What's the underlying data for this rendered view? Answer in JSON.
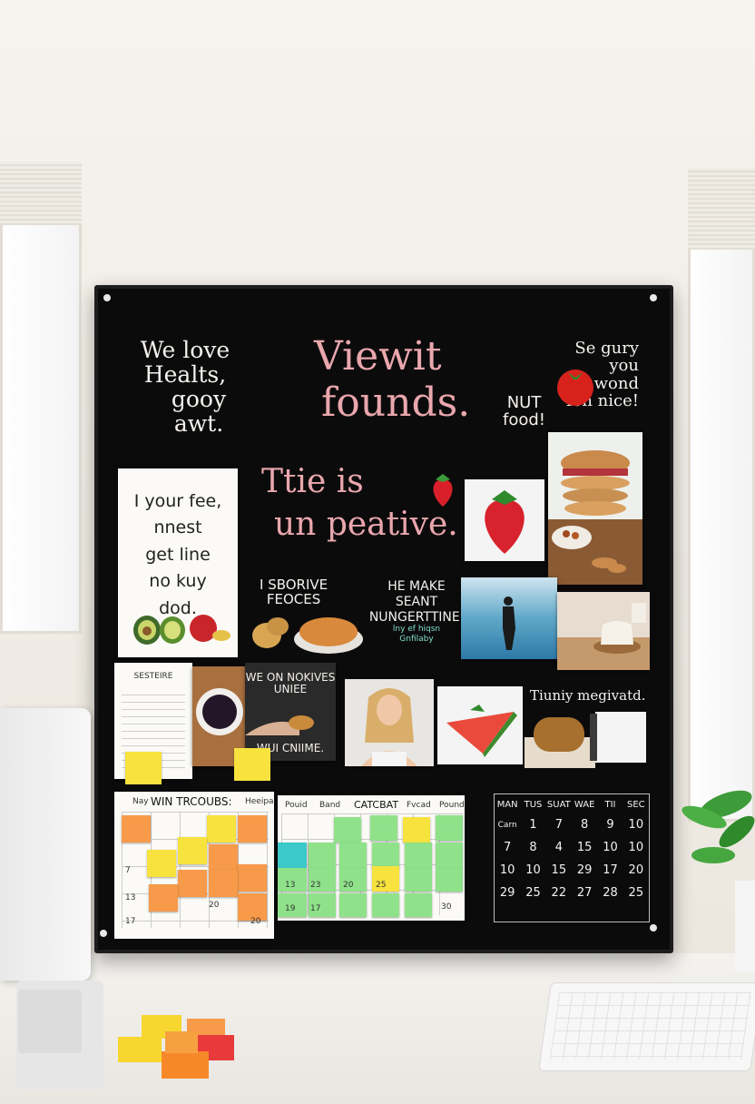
{
  "board": {
    "top_left": {
      "line1": "We love",
      "line2": "Healts,",
      "line3": "gooy",
      "line4": "awt."
    },
    "headline": {
      "line1": "Viewit",
      "line2": "founds."
    },
    "tagline": {
      "line1": "Ttie is",
      "line2": "un peative."
    },
    "top_right": {
      "line1": "Se gury",
      "line2": "you",
      "line3": "uwond",
      "line4": "fon nice!"
    },
    "nut_food": {
      "line1": "NUT",
      "line2": "food!"
    },
    "poster": {
      "line1": "I your fee,",
      "line2": "nnest",
      "line3": "get line",
      "line4": "no kuy",
      "line5": "dod."
    },
    "sborive": {
      "line1": "I SBORIVE",
      "line2": "FEOCES"
    },
    "make": {
      "line1": "HE MAKE",
      "line2": "SEANT",
      "line3": "NUNGERTTINE.",
      "line4": "lny ef hiqsn",
      "line5": "Gnfilaby"
    },
    "nokves": {
      "line1": "WE ON NOKIVES",
      "line2": "UNIEE",
      "line3": "WUI CNIIME."
    },
    "notepad_title": "SESTEIRE",
    "tiuniy": "Tiuniy megivatd.",
    "left_calendar": {
      "title": "WIN TRCOUBS:",
      "col_left": "Nay",
      "col_right": "Heeipa"
    },
    "mid_calendar": {
      "title": "CATCBAT",
      "headers": [
        "Pouid",
        "Band",
        "Fvcad",
        "Pound"
      ]
    },
    "dark_calendar": {
      "days": [
        "MAN",
        "TUS",
        "SUAT",
        "WAE",
        "TII",
        "SEC"
      ],
      "rows": [
        [
          "Carn",
          "1",
          "7",
          "8",
          "9",
          "10"
        ],
        [
          "7",
          "8",
          "4",
          "15",
          "10",
          "10"
        ],
        [
          "10",
          "10",
          "15",
          "29",
          "17",
          "20"
        ],
        [
          "29",
          "25",
          "22",
          "27",
          "28",
          "25"
        ]
      ]
    },
    "left_cal_numbers": [
      "7",
      "13",
      "20",
      "17",
      "20"
    ],
    "mid_cal_numbers": [
      "13",
      "23",
      "20",
      "25",
      "19",
      "17",
      "30"
    ]
  },
  "colors": {
    "board": "#0c0b0c",
    "chalk": "#f4f1ec",
    "pink": "#e9a7ad",
    "orange_note": "#f79a4a",
    "yellow_note": "#f7e23e",
    "green_note": "#8fe28a",
    "teal_note": "#3cc9c9"
  }
}
